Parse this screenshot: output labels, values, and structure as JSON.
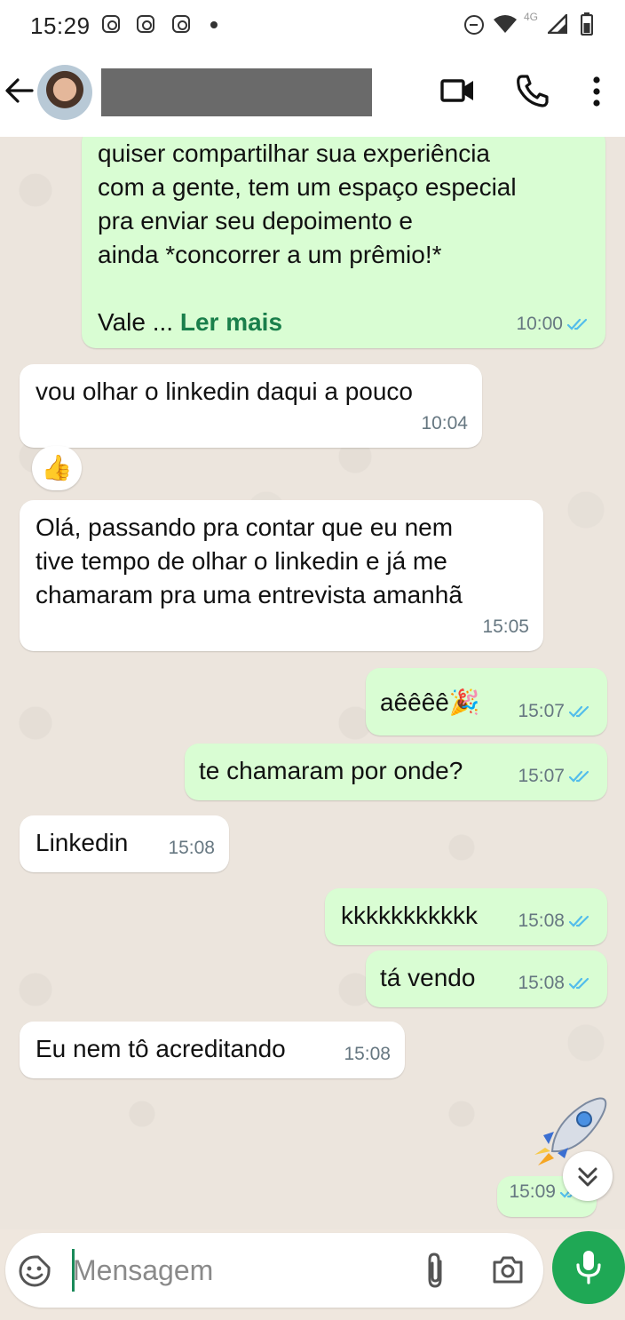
{
  "status_bar": {
    "time": "15:29",
    "network": "4G",
    "icons": [
      "instagram-icon",
      "instagram-icon",
      "instagram-icon",
      "notification-dot",
      "do-not-disturb-icon",
      "wifi-icon",
      "signal-icon",
      "battery-icon"
    ]
  },
  "header": {
    "contact_name_redacted": true,
    "icons": [
      "back-arrow-icon",
      "video-call-icon",
      "phone-icon",
      "more-vert-icon"
    ]
  },
  "messages": [
    {
      "direction": "out",
      "text": "quiser compartilhar sua experiência\ncom a gente, tem um espaço especial\npra enviar seu depoimento e\nainda *concorrer a um prêmio!*\n\nVale ... ",
      "read_more": "Ler mais",
      "time": "10:00",
      "status": "read"
    },
    {
      "direction": "in",
      "text": "vou olhar o linkedin daqui a pouco",
      "time": "10:04",
      "reaction": "👍"
    },
    {
      "direction": "in",
      "text": "Olá, passando pra contar que eu nem\ntive tempo de olhar o linkedin e já me\nchamaram pra uma entrevista amanhã",
      "time": "15:05"
    },
    {
      "direction": "out",
      "text": "aêêêê🎉",
      "time": "15:07",
      "status": "read"
    },
    {
      "direction": "out",
      "text": "te chamaram por onde?",
      "time": "15:07",
      "status": "read"
    },
    {
      "direction": "in",
      "text": "Linkedin",
      "time": "15:08"
    },
    {
      "direction": "out",
      "text": "kkkkkkkkkkk",
      "time": "15:08",
      "status": "read"
    },
    {
      "direction": "out",
      "text": "tá vendo",
      "time": "15:08",
      "status": "read"
    },
    {
      "direction": "in",
      "text": "Eu nem tô acreditando",
      "time": "15:08"
    },
    {
      "direction": "out",
      "sticker": "rocket-emoji",
      "time": "15:09",
      "status": "read"
    }
  ],
  "composer": {
    "placeholder": "Mensagem",
    "value": "",
    "icons": [
      "emoji-sticker-icon",
      "attach-icon",
      "camera-icon",
      "mic-icon"
    ]
  },
  "colors": {
    "outgoing_bubble": "#d9fdd3",
    "incoming_bubble": "#ffffff",
    "chat_background": "#ece5dd",
    "read_ticks": "#53bdeb",
    "read_more": "#1a7f4b",
    "mic_button": "#1fa855"
  }
}
